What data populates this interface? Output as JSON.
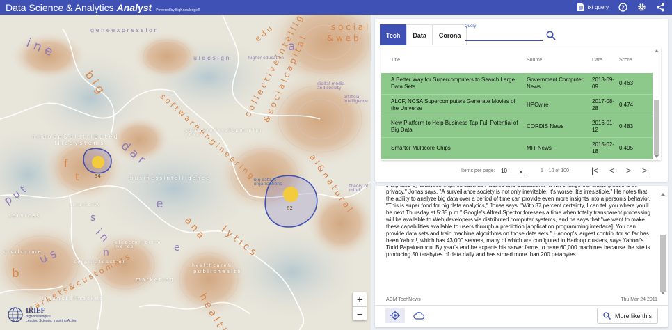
{
  "header": {
    "brand": "Data Science & Analytics",
    "brand_emphasis": "Analyst",
    "powered_by": "Powered by BigKnowledge®",
    "txt_query_label": "txt query",
    "icons": [
      "txt-query-icon",
      "help-icon",
      "gear-icon",
      "share-icon"
    ],
    "color": "#3f51b5"
  },
  "map": {
    "labels": [
      {
        "text": "g e n e   e x p r e s s i o n",
        "color": "purple"
      },
      {
        "text": "s o c i a l",
        "color": "orange"
      },
      {
        "text": "& w e b",
        "color": "orange"
      },
      {
        "text": "i n e",
        "color": "purple"
      },
      {
        "text": "e d u",
        "color": "orange"
      },
      {
        "text": "u i   d e s i g n",
        "color": "purple"
      },
      {
        "text": "higher education",
        "color": "purple"
      },
      {
        "text": "a",
        "color": "purple"
      },
      {
        "text": "s o f t w a r e   e n g i n e e r i n g",
        "color": "orange"
      },
      {
        "text": "c o l l e c t i v e   i n t e l l i g e n c e",
        "color": "orange"
      },
      {
        "text": "& s o c i a l   c a p i t a l",
        "color": "orange"
      },
      {
        "text": "digital media and society",
        "color": "purple"
      },
      {
        "text": "artificial intelligence",
        "color": "purple"
      },
      {
        "text": "b i g",
        "color": "orange"
      },
      {
        "text": "h a d o o p   &   d i s t r i b u t e d",
        "color": "white"
      },
      {
        "text": "f i l e   s y s t e m s",
        "color": "white"
      },
      {
        "text": "a l   &   n a t u r a l",
        "color": "orange"
      },
      {
        "text": "d a r",
        "color": "purple"
      },
      {
        "text": "s o f t w a r e   d e v e l o p m e n t   p r o c e s s",
        "color": "white"
      },
      {
        "text": "f",
        "color": "orange"
      },
      {
        "text": "t",
        "color": "orange"
      },
      {
        "text": "p u t",
        "color": "purple"
      },
      {
        "text": "b u s i n e s s   i n t e l l i g e n c e",
        "color": "white"
      },
      {
        "text": "big data in organizations",
        "color": "blue"
      },
      {
        "text": "theory of mind",
        "color": "purple"
      },
      {
        "text": "s m a r t   c i t y",
        "color": "white"
      },
      {
        "text": "s e r v i c e s",
        "color": "white"
      },
      {
        "text": "e",
        "color": "purple"
      },
      {
        "text": "a n a",
        "color": "orange"
      },
      {
        "text": "l y t i c s",
        "color": "orange"
      },
      {
        "text": "e l e c t r o n i c   c o m m e r c e",
        "color": "white"
      },
      {
        "text": "c i v i l   c r i m e",
        "color": "white"
      },
      {
        "text": "i n",
        "color": "purple"
      },
      {
        "text": "b",
        "color": "orange"
      },
      {
        "text": "u s",
        "color": "purple"
      },
      {
        "text": "c o r p o r a t e   a c t i o n",
        "color": "white"
      },
      {
        "text": "h e a l t h   c a r e   &",
        "color": "white"
      },
      {
        "text": "p u b l i c   h e a l t h",
        "color": "white"
      },
      {
        "text": "m a r k e t s   &   c u s t o m e r s",
        "color": "orange"
      },
      {
        "text": "m a r k e t i n g",
        "color": "white"
      },
      {
        "text": "f i n a n c i a l   m a r k e t",
        "color": "white"
      },
      {
        "text": "h e a l t h",
        "color": "orange"
      },
      {
        "text": "n",
        "color": "purple"
      },
      {
        "text": "s",
        "color": "purple"
      },
      {
        "text": "e",
        "color": "purple"
      }
    ],
    "clusters": [
      {
        "count": "34"
      },
      {
        "count": "62"
      }
    ],
    "zoom_in": "+",
    "zoom_out": "−",
    "logo_text": "IRIEF",
    "logo_sub_left": "BigKnowledge®",
    "logo_sub_right": "Leading Science, Inspiring Action"
  },
  "search": {
    "tabs": [
      {
        "label": "Tech",
        "active": true
      },
      {
        "label": "Data",
        "active": false
      },
      {
        "label": "Corona",
        "active": false
      }
    ],
    "query_label": "Query",
    "query_value": "",
    "search_icon": "search-icon",
    "columns": {
      "title": "Title",
      "source": "Source",
      "date": "Date",
      "score": "Score"
    },
    "rows": [
      {
        "title": "A Better Way for Supercomputers to Search Large Data Sets",
        "source": "Government Computer News",
        "date": "2013-09-09",
        "score": "0.463"
      },
      {
        "title": "ALCF, NCSA Supercomputers Generate Movies of the Universe",
        "source": "HPCwire",
        "date": "2017-08-28",
        "score": "0.474"
      },
      {
        "title": "New Platform to Help Business Tap Full Potential of Big Data",
        "source": "CORDIS News",
        "date": "2016-01-12",
        "score": "0.483"
      },
      {
        "title": "Smarter Multicore Chips",
        "source": "MIT News",
        "date": "2015-02-18",
        "score": "0.495"
      }
    ],
    "row_color": "#8cc98a",
    "paginator": {
      "items_per_page_label": "Items per page:",
      "items_per_page": "10",
      "range": "1 – 10 of 100",
      "first": "|<",
      "prev": "<",
      "next": ">",
      "last": ">|"
    }
  },
  "document": {
    "text": "integrated by analytics engines such as Hadoop and Cassandra. \"It will change our existing notions of privacy,\" Jonas says. \"A surveillance society is not only inevitable, it's worse. It's irresistible.\" He notes that the ability to analyze big data over a period of time can provide even more insights into a person's behavior. \"This is super food for big data analytics,\" Jonas says. \"With 87 percent certainty, I can tell you where you'll be next Thursday at 5:35 p.m.\" Google's Alfred Spector foresees a time when totally transparent processing will be available to Web developers via distributed computer systems, and he says that \"we want to make these capabilities available to users through a prediction [application programming interface]. You can provide data sets and train machine algorithms on those data sets.\" Hadoop's largest contributor so far has been Yahoo!, which has 43,000 servers, many of which are configured in Hadoop clusters, says Yahoo!'s Todd Papaioannou. By year's end he expects his server farms to have 60,000 machines because the site is producing 50 terabytes of data daily and has stored more than 200 petabytes.",
    "source": "ACM TechNews",
    "date": "Thu Mar 24 2011",
    "actions": [
      "locate-icon",
      "cloud-icon"
    ],
    "more_like_this": "More like this"
  }
}
